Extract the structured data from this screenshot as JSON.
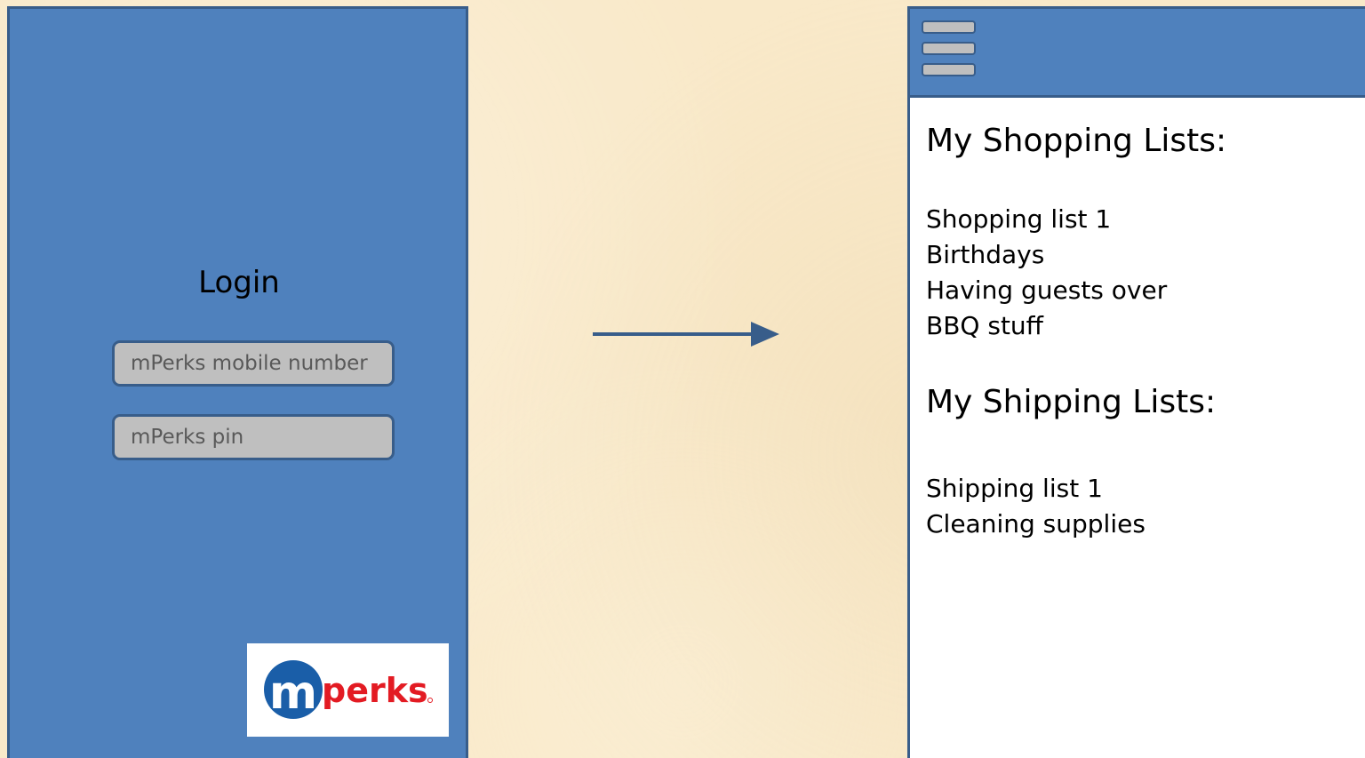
{
  "login_screen": {
    "title": "Login",
    "mobile_number_field": {
      "placeholder": "mPerks mobile number",
      "value": ""
    },
    "pin_field": {
      "placeholder": "mPerks pin",
      "value": ""
    },
    "logo": {
      "icon": "mperks-logo",
      "text": "perks"
    }
  },
  "flow_arrow": {
    "icon": "arrow-right-icon"
  },
  "lists_screen": {
    "menu_icon": "hamburger-menu-icon",
    "shopping_section": {
      "title": "My Shopping Lists:",
      "items": [
        "Shopping list 1",
        "Birthdays",
        "Having guests over",
        "BBQ stuff"
      ]
    },
    "shipping_section": {
      "title": "My Shipping Lists:",
      "items": [
        "Shipping list 1",
        "Cleaning supplies"
      ]
    }
  },
  "colors": {
    "panel_blue": "#4f81bd",
    "border_blue": "#385d8a",
    "field_gray": "#bfbfbf",
    "logo_blue": "#1a5ea8",
    "logo_red": "#e31b23",
    "background": "#f9e9c9"
  }
}
